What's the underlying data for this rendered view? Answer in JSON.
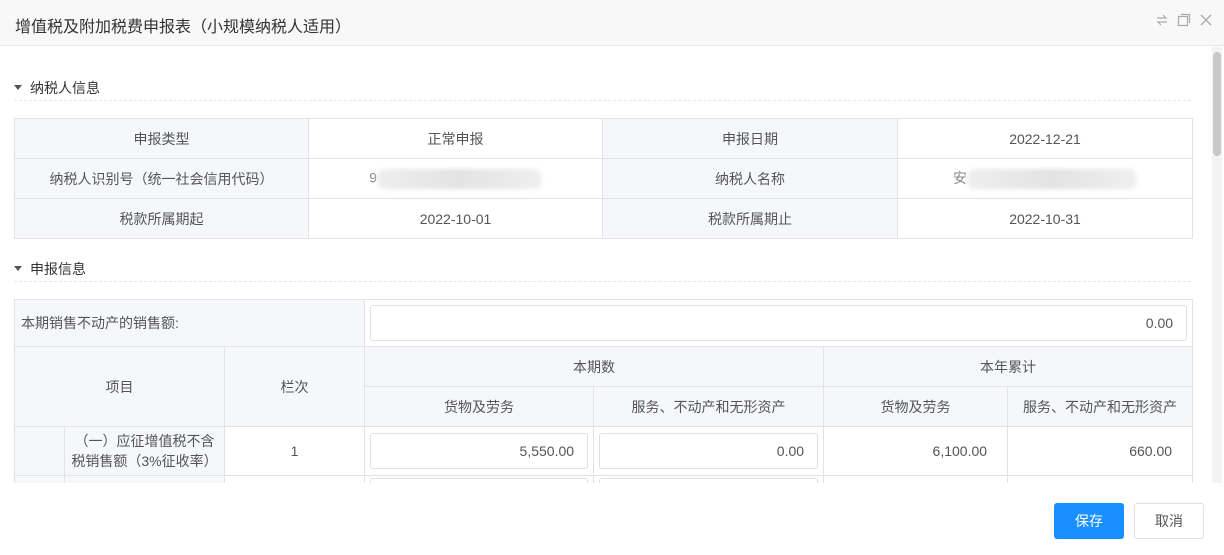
{
  "dialog": {
    "title": "增值税及附加税费申报表（小规模纳税人适用）",
    "icons": [
      "restore-icon",
      "maximize-icon",
      "close-icon"
    ]
  },
  "taxpayer_section": {
    "title": "纳税人信息",
    "rows": [
      {
        "label1": "申报类型",
        "value1": "正常申报",
        "label2": "申报日期",
        "value2": "2022-12-21"
      },
      {
        "label1": "纳税人识别号（统一社会信用代码）",
        "value1": "9",
        "label2": "纳税人名称",
        "value2": "安"
      },
      {
        "label1": "税款所属期起",
        "value1": "2022-10-01",
        "label2": "税款所属期止",
        "value2": "2022-10-31"
      }
    ]
  },
  "declare_section": {
    "title": "申报信息",
    "real_estate_label": "本期销售不动产的销售额:",
    "real_estate_value": "0.00",
    "headers": {
      "item": "项目",
      "col_no": "栏次",
      "current_period": "本期数",
      "year_total": "本年累计",
      "goods": "货物及劳务",
      "services": "服务、不动产和无形资产",
      "goods2": "货物及劳务",
      "services2": "服务、不动产和无形资产"
    },
    "rows": [
      {
        "item": "（一）应征增值税不含税销售额（3%征收率）",
        "col_no": "1",
        "cur_goods": "5,550.00",
        "cur_services": "0.00",
        "year_goods": "6,100.00",
        "year_services": "660.00"
      }
    ]
  },
  "footer": {
    "save_label": "保存",
    "cancel_label": "取消"
  },
  "colors": {
    "accent": "#1890ff",
    "label_bg": "#f5f7fa",
    "border": "#e3e3e3"
  }
}
